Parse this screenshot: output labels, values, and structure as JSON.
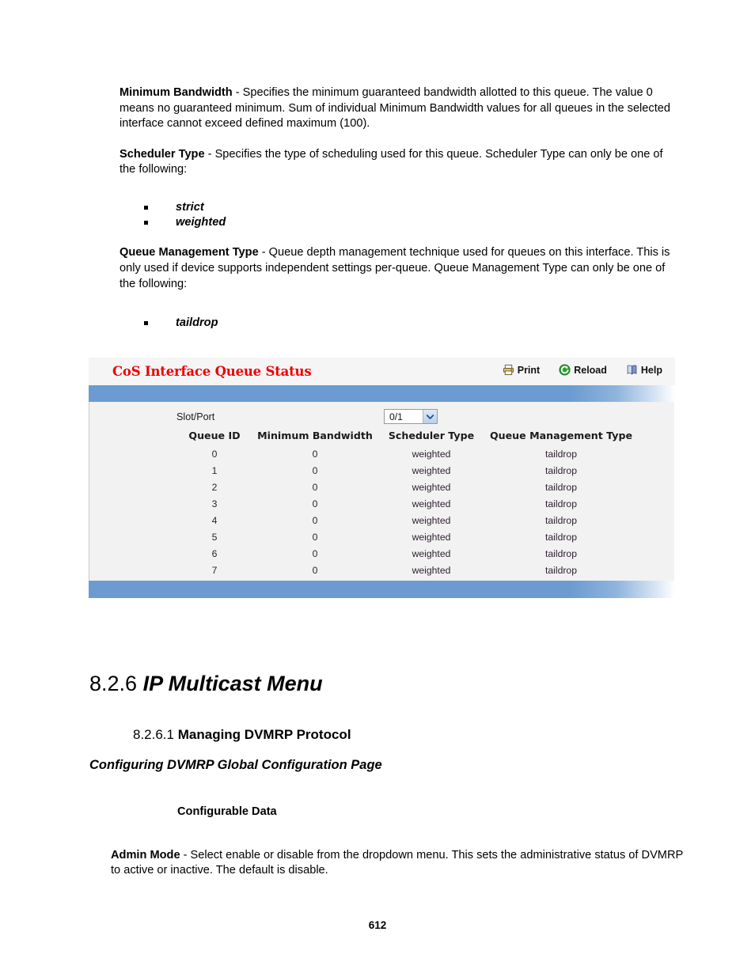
{
  "document": {
    "page_number": "612",
    "paragraphs": [
      {
        "term": "Minimum Bandwidth",
        "text": " - Specifies the minimum guaranteed bandwidth allotted to this queue. The value 0 means no guaranteed minimum. Sum of individual Minimum Bandwidth values for all queues in the selected interface cannot exceed defined maximum (100)."
      },
      {
        "term": "Scheduler Type",
        "text": " - Specifies the type of scheduling used for this queue. Scheduler Type can only be one of the following:"
      },
      {
        "term": "Queue Management Type",
        "text": " - Queue depth management technique used for queues on this interface. This is only used if device supports independent settings per-queue. Queue Management Type can only be one of the following:"
      }
    ],
    "scheduler_type_options": [
      "strict",
      "weighted"
    ],
    "queue_management_options": [
      "taildrop"
    ],
    "section_heading": {
      "number": "8.2.6",
      "title": "IP Multicast Menu"
    },
    "subsection_heading": {
      "number": "8.2.6.1",
      "title": "Managing DVMRP Protocol"
    },
    "page_heading": "Configuring DVMRP Global Configuration Page",
    "configurable_data_label": "Configurable Data",
    "admin_mode": {
      "term": "Admin Mode",
      "text": " - Select enable or disable from the dropdown menu. This sets the administrative status of DVMRP to active or inactive. The default is disable."
    }
  },
  "screenshot_panel": {
    "title": "CoS Interface Queue Status",
    "title_color": "#ee0000",
    "accent_color": "#6b9bd1",
    "actions": [
      {
        "label": "Print",
        "icon": "printer-icon"
      },
      {
        "label": "Reload",
        "icon": "reload-icon"
      },
      {
        "label": "Help",
        "icon": "help-book-icon"
      }
    ],
    "slot_port": {
      "label": "Slot/Port",
      "value": "0/1",
      "options": [
        "0/1"
      ]
    },
    "table": {
      "columns": [
        "Queue ID",
        "Minimum Bandwidth",
        "Scheduler Type",
        "Queue Management Type"
      ],
      "rows": [
        [
          "0",
          "0",
          "weighted",
          "taildrop"
        ],
        [
          "1",
          "0",
          "weighted",
          "taildrop"
        ],
        [
          "2",
          "0",
          "weighted",
          "taildrop"
        ],
        [
          "3",
          "0",
          "weighted",
          "taildrop"
        ],
        [
          "4",
          "0",
          "weighted",
          "taildrop"
        ],
        [
          "5",
          "0",
          "weighted",
          "taildrop"
        ],
        [
          "6",
          "0",
          "weighted",
          "taildrop"
        ],
        [
          "7",
          "0",
          "weighted",
          "taildrop"
        ]
      ]
    }
  }
}
